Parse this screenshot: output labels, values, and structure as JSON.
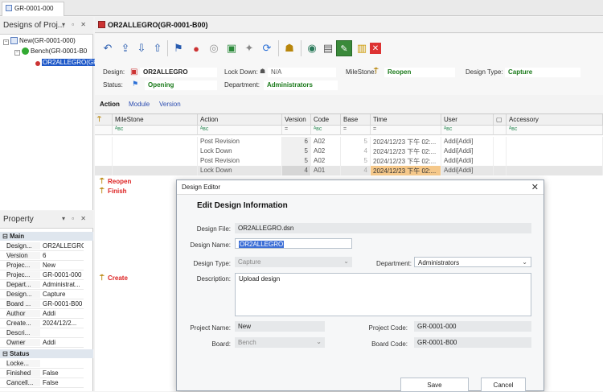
{
  "doc_tab": {
    "label": "GR-0001-000"
  },
  "tree_panel": {
    "title": "Designs of Proj...",
    "nodes": [
      {
        "label": "New(GR-0001-000)"
      },
      {
        "label": "Bench(GR-0001-B0"
      },
      {
        "label": "OR2ALLEGRO(GR-0"
      }
    ]
  },
  "property_panel": {
    "title": "Property",
    "groups": {
      "main": {
        "label": "Main"
      },
      "status": {
        "label": "Status"
      }
    },
    "main_rows": [
      {
        "k": "Design...",
        "v": "OR2ALLEGRO"
      },
      {
        "k": "Version",
        "v": "6"
      },
      {
        "k": "Projec...",
        "v": "New"
      },
      {
        "k": "Projec...",
        "v": "GR-0001-000"
      },
      {
        "k": "Depart...",
        "v": "Administrat..."
      },
      {
        "k": "Design...",
        "v": "Capture"
      },
      {
        "k": "Board ...",
        "v": "GR-0001-B00"
      },
      {
        "k": "Author",
        "v": "Addi"
      },
      {
        "k": "Create...",
        "v": "2024/12/2..."
      },
      {
        "k": "Descri...",
        "v": ""
      },
      {
        "k": "Owner",
        "v": "Addi"
      }
    ],
    "status_rows": [
      {
        "k": "Locke...",
        "v": ""
      },
      {
        "k": "Finished",
        "v": "False"
      },
      {
        "k": "Cancell...",
        "v": "False"
      }
    ]
  },
  "main": {
    "title": "OR2ALLEGRO(GR-0001-B00)",
    "info": {
      "design_label": "Design:",
      "design_value": "OR2ALLEGRO",
      "lockdown_label": "Lock Down:",
      "lockdown_value": "N/A",
      "milestone_label": "MileStone:",
      "milestone_value": "Reopen",
      "designtype_label": "Design Type:",
      "designtype_value": "Capture",
      "status_label": "Status:",
      "status_value": "Opening",
      "department_label": "Department:",
      "department_value": "Administrators"
    },
    "subtabs": [
      "Action",
      "Module",
      "Version"
    ]
  },
  "grid": {
    "columns": [
      "MileStone",
      "Action",
      "Version",
      "Code",
      "Base",
      "Time",
      "User",
      "",
      "Accessory"
    ],
    "filter_eq": "=",
    "filter_abc": "ᴬʙᴄ",
    "rows": [
      {
        "action": "Post Revision",
        "version": "6",
        "code": "A02",
        "base": "5",
        "time": "2024/12/23 下午 02:...",
        "user": "Addi[Addi]"
      },
      {
        "action": "Lock Down",
        "version": "5",
        "code": "A02",
        "base": "4",
        "time": "2024/12/23 下午 02:...",
        "user": "Addi[Addi]"
      },
      {
        "action": "Post Revision",
        "version": "5",
        "code": "A02",
        "base": "5",
        "time": "2024/12/23 下午 02:...",
        "user": "Addi[Addi]"
      },
      {
        "action": "Lock Down",
        "version": "4",
        "code": "A01",
        "base": "4",
        "time": "2024/12/23 下午 02:...",
        "user": "Addi[Addi]"
      }
    ],
    "milestones": {
      "reopen": "Reopen",
      "finish": "Finish",
      "create": "Create"
    }
  },
  "dialog": {
    "title": "Design Editor",
    "heading": "Edit Design Information",
    "design_file_label": "Design File:",
    "design_file_value": "OR2ALLEGRO.dsn",
    "design_name_label": "Design Name:",
    "design_name_value": "OR2ALLEGRO",
    "design_type_label": "Design Type:",
    "design_type_value": "Capture",
    "department_label": "Department:",
    "department_value": "Administrators",
    "description_label": "Description:",
    "description_value": "Upload design",
    "project_name_label": "Project Name:",
    "project_name_value": "New",
    "project_code_label": "Project Code:",
    "project_code_value": "GR-0001-000",
    "board_label": "Board:",
    "board_value": "Bench",
    "board_code_label": "Board Code:",
    "board_code_value": "GR-0001-B00",
    "save_label": "Save",
    "cancel_label": "Cancel"
  }
}
